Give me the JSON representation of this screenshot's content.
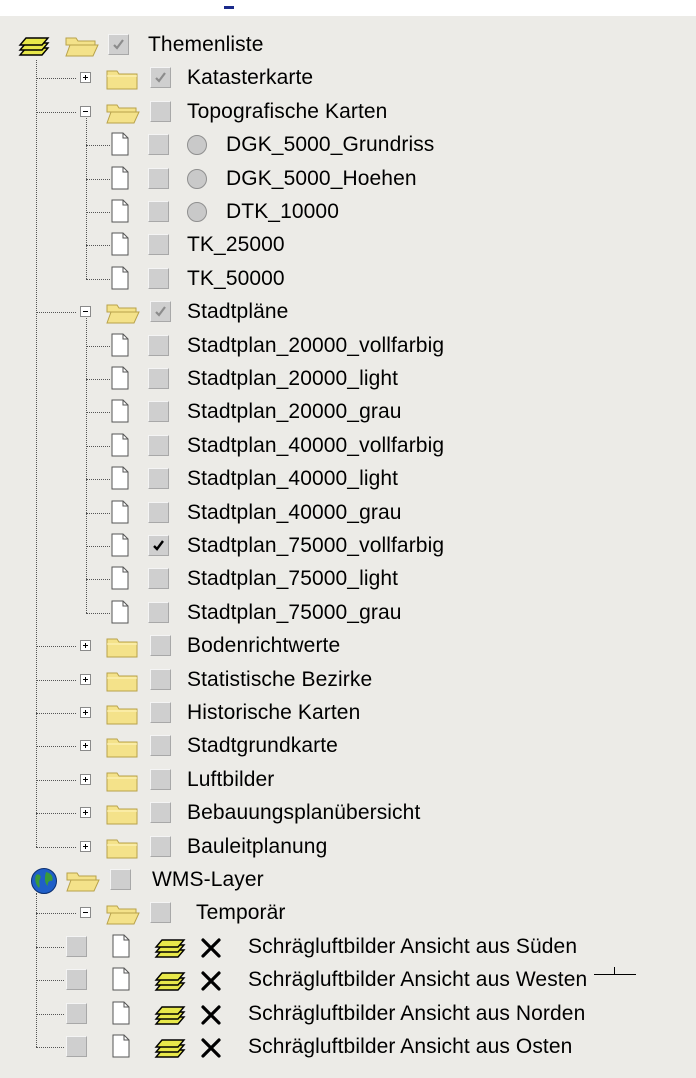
{
  "tree": {
    "root": {
      "label": "Themenliste",
      "checked": "grayed"
    },
    "groups": [
      {
        "label": "Katasterkarte",
        "state": "collapsed",
        "checked": "grayed"
      },
      {
        "label": "Topografische Karten",
        "state": "expanded",
        "checked": "none",
        "children": [
          {
            "label": "DGK_5000_Grundriss",
            "radio": true
          },
          {
            "label": "DGK_5000_Hoehen",
            "radio": true
          },
          {
            "label": "DTK_10000",
            "radio": true
          },
          {
            "label": "TK_25000"
          },
          {
            "label": "TK_50000"
          }
        ]
      },
      {
        "label": "Stadtpläne",
        "state": "expanded",
        "checked": "grayed",
        "children": [
          {
            "label": "Stadtplan_20000_vollfarbig"
          },
          {
            "label": "Stadtplan_20000_light"
          },
          {
            "label": "Stadtplan_20000_grau"
          },
          {
            "label": "Stadtplan_40000_vollfarbig"
          },
          {
            "label": "Stadtplan_40000_light"
          },
          {
            "label": "Stadtplan_40000_grau"
          },
          {
            "label": "Stadtplan_75000_vollfarbig",
            "checked": "checked"
          },
          {
            "label": "Stadtplan_75000_light"
          },
          {
            "label": "Stadtplan_75000_grau"
          }
        ]
      },
      {
        "label": "Bodenrichtwerte",
        "state": "collapsed"
      },
      {
        "label": "Statistische Bezirke",
        "state": "collapsed"
      },
      {
        "label": "Historische Karten",
        "state": "collapsed"
      },
      {
        "label": "Stadtgrundkarte",
        "state": "collapsed"
      },
      {
        "label": "Luftbilder",
        "state": "collapsed"
      },
      {
        "label": "Bebauungsplanübersicht",
        "state": "collapsed"
      },
      {
        "label": "Bauleitplanung",
        "state": "collapsed"
      }
    ],
    "wms": {
      "label": "WMS-Layer",
      "folder": {
        "label": "Temporär",
        "state": "expanded"
      },
      "layers": [
        {
          "label": "Schrägluftbilder Ansicht aus Süden"
        },
        {
          "label": "Schrägluftbilder Ansicht aus Westen"
        },
        {
          "label": "Schrägluftbilder Ansicht aus Norden"
        },
        {
          "label": "Schrägluftbilder Ansicht aus Osten"
        }
      ]
    }
  },
  "colors": {
    "background": "#ecebe7",
    "folder": "#f4e28a",
    "folder_dark": "#b8a24a",
    "layer_icon": "#e8e84a",
    "tree_lines": "#555555",
    "checkbox": "#cfcfcf"
  },
  "icons": {
    "root": "layer-stack-icon",
    "group": "folder-icon",
    "leaf": "document-icon",
    "wms_root": "globe-icon",
    "wms_layer": "layer-stack-icon",
    "wms_status": "x-mark-icon"
  }
}
